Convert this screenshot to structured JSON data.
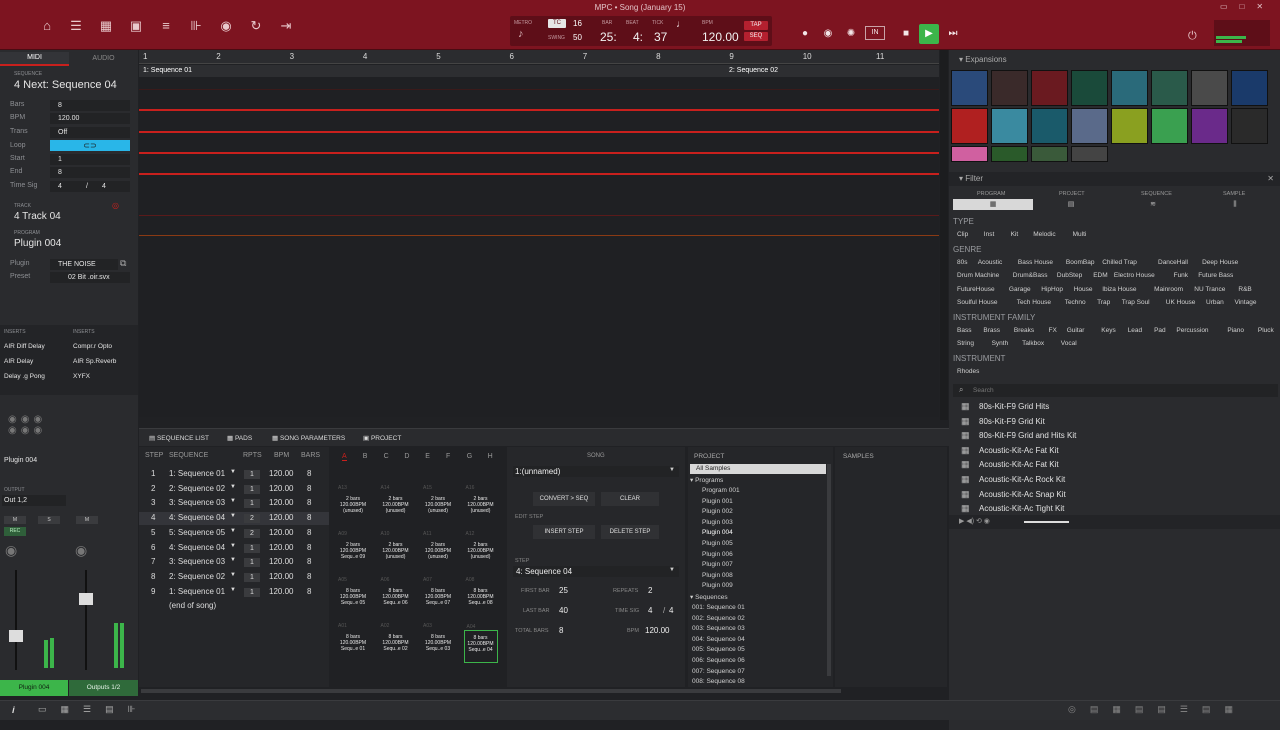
{
  "window": {
    "title": "MPC • Song (January 15)"
  },
  "transport": {
    "metro": "METRO",
    "tc": "TC",
    "tc_val": "16",
    "swing_lab": "SWING",
    "swing": "50",
    "bar_lab": "BAR",
    "beat_lab": "BEAT",
    "tick_lab": "TICK",
    "bar": "25:",
    "beat": "4:",
    "tick": "37",
    "bpm_lab": "BPM",
    "bpm": "120.00",
    "tap": "TAP",
    "seq": "SEQ"
  },
  "left": {
    "mode_tabs": [
      "MIDI",
      "AUDIO"
    ],
    "seq_section": "SEQUENCE",
    "seq_name": "4 Next: Sequence 04",
    "bars_lab": "Bars",
    "bars": "8",
    "bpm_lab": "BPM",
    "bpm": "120.00",
    "trans_lab": "Trans",
    "trans": "Off",
    "loop_lab": "Loop",
    "start_lab": "Start",
    "start": "1",
    "end_lab": "End",
    "end": "8",
    "timesig_lab": "Time Sig",
    "ts_num": "4",
    "ts_sep": "/",
    "ts_den": "4",
    "track_section": "TRACK",
    "track_name": "4 Track 04",
    "program_section": "PROGRAM",
    "program_name": "Plugin 004",
    "plugin_lab": "Plugin",
    "plugin": "THE NOISE",
    "preset_lab": "Preset",
    "preset": "02 Bit .oir.svx",
    "inserts_left_lab": "INSERTS",
    "inserts_right_lab": "INSERTS",
    "inserts_left": [
      "AIR Diff Delay",
      "AIR Delay",
      "Delay .g Pong"
    ],
    "inserts_right": [
      "Compr.r Opto",
      "AIR Sp.Reverb",
      "XYFX"
    ],
    "strip_name": "Plugin 004",
    "output_lab": "OUTPUT",
    "output": "Out 1,2",
    "m": "M",
    "s": "S",
    "m2": "M",
    "rec": "REC",
    "bottom_left": "Plugin 004",
    "bottom_right": "Outputs 1/2"
  },
  "ruler": [
    "1",
    "2",
    "3",
    "4",
    "5",
    "6",
    "7",
    "8",
    "9",
    "10",
    "11"
  ],
  "sequences_in_arrange": [
    "1: Sequence 01",
    "2: Sequence 02"
  ],
  "bottom_tabs": [
    "SEQUENCE LIST",
    "PADS",
    "SONG PARAMETERS",
    "PROJECT"
  ],
  "seqlist": {
    "headers": [
      "STEP",
      "SEQUENCE",
      "RPTS",
      "BPM",
      "BARS"
    ],
    "rows": [
      {
        "step": "1",
        "seq": "1: Sequence 01",
        "rpts": "1",
        "bpm": "120.00",
        "bars": "8"
      },
      {
        "step": "2",
        "seq": "2: Sequence 02",
        "rpts": "1",
        "bpm": "120.00",
        "bars": "8"
      },
      {
        "step": "3",
        "seq": "3: Sequence 03",
        "rpts": "1",
        "bpm": "120.00",
        "bars": "8"
      },
      {
        "step": "4",
        "seq": "4: Sequence 04",
        "rpts": "2",
        "bpm": "120.00",
        "bars": "8"
      },
      {
        "step": "5",
        "seq": "5: Sequence 05",
        "rpts": "2",
        "bpm": "120.00",
        "bars": "8"
      },
      {
        "step": "6",
        "seq": "4: Sequence 04",
        "rpts": "1",
        "bpm": "120.00",
        "bars": "8"
      },
      {
        "step": "7",
        "seq": "3: Sequence 03",
        "rpts": "1",
        "bpm": "120.00",
        "bars": "8"
      },
      {
        "step": "8",
        "seq": "2: Sequence 02",
        "rpts": "1",
        "bpm": "120.00",
        "bars": "8"
      },
      {
        "step": "9",
        "seq": "1: Sequence 01",
        "rpts": "1",
        "bpm": "120.00",
        "bars": "8"
      }
    ],
    "end": "(end of song)"
  },
  "pads": {
    "banks": [
      "A",
      "B",
      "C",
      "D",
      "E",
      "F",
      "G",
      "H"
    ],
    "cells": [
      {
        "id": "A13",
        "t": [
          "2 bars",
          "120.00BPM",
          "(unused)"
        ]
      },
      {
        "id": "A14",
        "t": [
          "2 bars",
          "120.00BPM",
          "(unused)"
        ]
      },
      {
        "id": "A15",
        "t": [
          "2 bars",
          "120.00BPM",
          "(unused)"
        ]
      },
      {
        "id": "A16",
        "t": [
          "2 bars",
          "120.00BPM",
          "(unused)"
        ]
      },
      {
        "id": "A09",
        "t": [
          "2 bars",
          "120.00BPM",
          "Sequ..e 09"
        ]
      },
      {
        "id": "A10",
        "t": [
          "2 bars",
          "120.00BPM",
          "(unused)"
        ]
      },
      {
        "id": "A11",
        "t": [
          "2 bars",
          "120.00BPM",
          "(unused)"
        ]
      },
      {
        "id": "A12",
        "t": [
          "2 bars",
          "120.00BPM",
          "(unused)"
        ]
      },
      {
        "id": "A05",
        "t": [
          "8 bars",
          "120.00BPM",
          "Sequ..e 05"
        ]
      },
      {
        "id": "A06",
        "t": [
          "8 bars",
          "120.00BPM",
          "Sequ..e 06"
        ]
      },
      {
        "id": "A07",
        "t": [
          "8 bars",
          "120.00BPM",
          "Sequ..e 07"
        ]
      },
      {
        "id": "A08",
        "t": [
          "8 bars",
          "120.00BPM",
          "Sequ..e 08"
        ]
      },
      {
        "id": "A01",
        "t": [
          "8 bars",
          "120.00BPM",
          "Sequ..e 01"
        ]
      },
      {
        "id": "A02",
        "t": [
          "8 bars",
          "120.00BPM",
          "Sequ..e 02"
        ]
      },
      {
        "id": "A03",
        "t": [
          "8 bars",
          "120.00BPM",
          "Sequ..e 03"
        ]
      },
      {
        "id": "A04",
        "t": [
          "8 bars",
          "120.00BPM",
          "Sequ..e 04"
        ]
      }
    ]
  },
  "song": {
    "header": "SONG",
    "song_name": "1:(unnamed)",
    "convert": "CONVERT > SEQ",
    "clear": "CLEAR",
    "edit_step": "EDIT STEP",
    "insert": "INSERT STEP",
    "delete": "DELETE STEP",
    "step_lab": "STEP",
    "step_val": "4: Sequence 04",
    "first_bar_lab": "FIRST BAR",
    "first_bar": "25",
    "repeats_lab": "REPEATS",
    "repeats": "2",
    "last_bar_lab": "LAST BAR",
    "last_bar": "40",
    "timesig_lab": "TIME SIG",
    "ts_num": "4",
    "ts_sep": "/",
    "ts_den": "4",
    "total_lab": "TOTAL BARS",
    "total": "8",
    "bpm_lab": "BPM",
    "bpm": "120.00"
  },
  "project": {
    "header": "PROJECT",
    "all_samples": "All Samples",
    "programs": "Programs",
    "program_items": [
      "Program 001",
      "Plugin 001",
      "Plugin 002",
      "Plugin 003",
      "Plugin 004",
      "Plugin 005",
      "Plugin 006",
      "Plugin 007",
      "Plugin 008",
      "Plugin 009"
    ],
    "sequences": "Sequences",
    "sequence_items": [
      "001: Sequence 01",
      "002: Sequence 02",
      "003: Sequence 03",
      "004: Sequence 04",
      "005: Sequence 05",
      "006: Sequence 06",
      "007: Sequence 07",
      "008: Sequence 08"
    ]
  },
  "samples": {
    "header": "SAMPLES"
  },
  "right": {
    "expansions": "Expansions",
    "filter": "Filter",
    "filter_tabs": [
      "PROGRAM",
      "PROJECT",
      "SEQUENCE",
      "SAMPLE"
    ],
    "type_lab": "TYPE",
    "types": [
      "Clip",
      "Inst",
      "Kit",
      "Melodic",
      "Multi"
    ],
    "genre_lab": "GENRE",
    "genre_rows": [
      [
        "80s",
        "Acoustic",
        "Bass House",
        "BoomBap",
        "Chilled Trap",
        "DanceHall",
        "Deep House"
      ],
      [
        "Drum Machine",
        "Drum&Bass",
        "DubStep",
        "EDM",
        "Electro House",
        "Funk",
        "Future Bass"
      ],
      [
        "FutureHouse",
        "Garage",
        "HipHop",
        "House",
        "Ibiza House",
        "Mainroom",
        "NU Trance",
        "R&B"
      ],
      [
        "Soulful House",
        "Tech House",
        "Techno",
        "Trap",
        "Trap Soul",
        "UK House",
        "Urban",
        "Vintage"
      ]
    ],
    "family_lab": "INSTRUMENT FAMILY",
    "family_rows": [
      [
        "Bass",
        "Brass",
        "Breaks",
        "FX",
        "Guitar",
        "Keys",
        "Lead",
        "Pad",
        "Percussion",
        "Piano",
        "Pluck"
      ],
      [
        "String",
        "Synth",
        "Talkbox",
        "Vocal"
      ]
    ],
    "instrument_lab": "INSTRUMENT",
    "instruments": [
      "Rhodes"
    ],
    "search_placeholder": "Search",
    "results": [
      "80s-Kit-F9 Grid Hits",
      "80s-Kit-F9 Grid Kit",
      "80s-Kit-F9 Grid and Hits Kit",
      "Acoustic-Kit-Ac Fat Kit",
      "Acoustic-Kit-Ac Fat Kit",
      "Acoustic-Kit-Ac Rock Kit",
      "Acoustic-Kit-Ac Snap Kit",
      "Acoustic-Kit-Ac Tight Kit"
    ]
  },
  "colors": {
    "accent": "#7d1420",
    "loop": "#29b6e8",
    "play": "#3cb54a",
    "lane": "#c8201d"
  }
}
